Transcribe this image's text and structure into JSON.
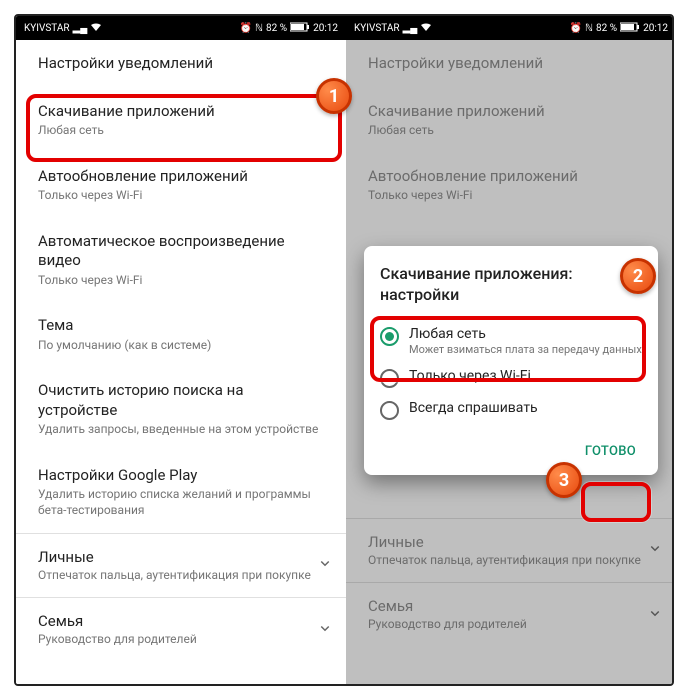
{
  "status": {
    "carrier": "KYIVSTAR",
    "battery": "82 %",
    "time": "20:12"
  },
  "left": {
    "items": [
      {
        "title": "Настройки уведомлений",
        "sub": ""
      },
      {
        "title": "Скачивание приложений",
        "sub": "Любая сеть"
      },
      {
        "title": "Автообновление приложений",
        "sub": "Только через Wi-Fi"
      },
      {
        "title": "Автоматическое воспроизведение видео",
        "sub": "Только через Wi-Fi"
      },
      {
        "title": "Тема",
        "sub": "По умолчанию (как в системе)"
      },
      {
        "title": "Очистить историю поиска на устройстве",
        "sub": "Удалить запросы, введенные на этом устройстве"
      },
      {
        "title": "Настройки Google Play",
        "sub": "Удалить историю списка желаний и программы бета-тестирования"
      }
    ],
    "groups": [
      {
        "title": "Личные",
        "sub": "Отпечаток пальца, аутентификация при покупке"
      },
      {
        "title": "Семья",
        "sub": "Руководство для родителей"
      }
    ]
  },
  "right": {
    "items": [
      {
        "title": "Настройки уведомлений",
        "sub": ""
      },
      {
        "title": "Скачивание приложений",
        "sub": "Любая сеть"
      },
      {
        "title": "Автообновление приложений",
        "sub": "Только через Wi-Fi"
      }
    ],
    "groups": [
      {
        "title": "Личные",
        "sub": "Отпечаток пальца, аутентификация при покупке"
      },
      {
        "title": "Семья",
        "sub": "Руководство для родителей"
      }
    ]
  },
  "dialog": {
    "title": "Скачивание приложения: настройки",
    "options": [
      {
        "title": "Любая сеть",
        "sub": "Может взиматься плата за передачу данных",
        "checked": true
      },
      {
        "title": "Только через Wi-Fi",
        "sub": "",
        "checked": false
      },
      {
        "title": "Всегда спрашивать",
        "sub": "",
        "checked": false
      }
    ],
    "done": "ГОТОВО"
  },
  "badges": {
    "1": "1",
    "2": "2",
    "3": "3"
  }
}
